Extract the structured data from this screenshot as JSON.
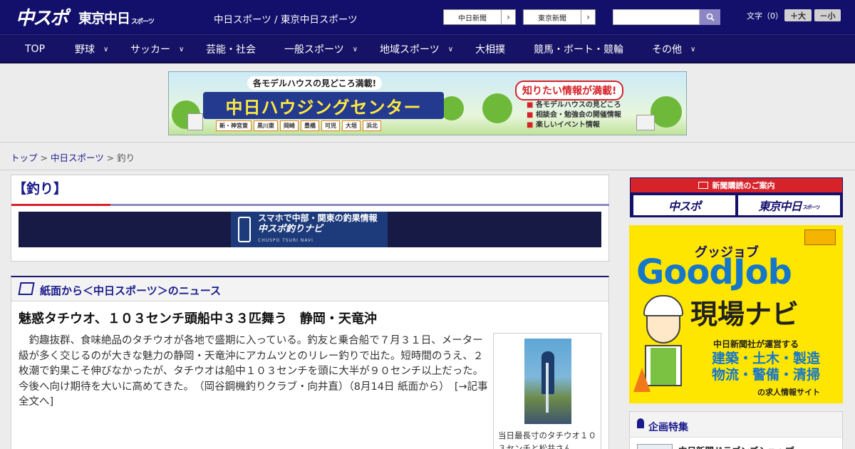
{
  "header": {
    "logo_chuspo": "中スポ",
    "logo_tokyo": "東京中日",
    "logo_tokyo_suffix": "スポーツ",
    "site_title": "中日スポーツ / 東京中日スポーツ",
    "paper_links": [
      {
        "label": "中日新聞",
        "arrow": "›"
      },
      {
        "label": "東京新聞",
        "arrow": "›"
      }
    ],
    "search_placeholder": "",
    "font_size_label": "文字（0）",
    "font_bigger": "＋大",
    "font_smaller": "－小"
  },
  "nav": {
    "items": [
      {
        "label": "TOP",
        "has_menu": false
      },
      {
        "label": "野球",
        "has_menu": true
      },
      {
        "label": "サッカー",
        "has_menu": true
      },
      {
        "label": "芸能・社会",
        "has_menu": false
      },
      {
        "label": "一般スポーツ",
        "has_menu": true
      },
      {
        "label": "地域スポーツ",
        "has_menu": true
      },
      {
        "label": "大相撲",
        "has_menu": false
      },
      {
        "label": "競馬・ボート・競輪",
        "has_menu": false
      },
      {
        "label": "その他",
        "has_menu": true
      }
    ],
    "chevron": "∨"
  },
  "top_ad": {
    "tagline": "各モデルハウスの見どころ満載!",
    "title": "中日ハウジングセンター",
    "areas": [
      "新・神宮東",
      "黒川東",
      "岡崎",
      "豊橋",
      "可児",
      "大垣",
      "浜北"
    ],
    "right_title": "知りたい情報が満載!",
    "right_list": [
      "各モデルハウスの見どころ",
      "相談会・勉強会の開催情報",
      "楽しいイベント情報"
    ]
  },
  "breadcrumb": {
    "items": [
      "トップ",
      "中日スポーツ"
    ],
    "separator": " > ",
    "current": "釣り"
  },
  "category": {
    "title": "【釣り】",
    "banner_line1": "スマホで中部・関東の釣果情報",
    "banner_line2": "中スポ釣りナビ",
    "banner_line3": "CHUSPO TSURI NAVI"
  },
  "news": {
    "section_title": "紙面から＜中日スポーツ＞のニュース",
    "headline": "魅惑タチウオ、１０３センチ頭船中３３匹舞う　静岡・天竜沖",
    "body": "釣趣抜群、食味絶品のタチウオが各地で盛期に入っている。釣友と乗合船で７月３１日、メーター級が多く交じるのが大きな魅力の静岡・天竜沖にアカムツとのリレー釣りで出た。短時間のうえ、２枚潮で釣果こそ伸びなかったが、タチウオは船中１０３センチを頭に大半が９０センチ以上だった。今後へ向け期待を大いに高めてきた。　（岡谷鋼機釣りクラブ・向井直）（8月14日 紙面から）　",
    "more_link": "[→記事全文へ]",
    "photo_caption": "当日最長寸のタチウオ１０３センチと松井さん"
  },
  "sidebar": {
    "subscription_title": "新聞購読のご案内",
    "subscription_chuspo": "中スポ",
    "subscription_tokyo": "東京中日",
    "subscription_tokyo_suffix": "スポーツ",
    "goodjob_kana": "グッジョブ",
    "goodjob_title": "GoodJob",
    "goodjob_navi": "現場ナビ",
    "goodjob_desc1": "中日新聞社が運営する",
    "goodjob_desc2a": "建築・土木・製造",
    "goodjob_desc2b": "物流・警備・清掃",
    "goodjob_desc3": "の求人情報サイト",
    "kikaku_title": "企画特集",
    "kikaku_item": "中日新聞ドラゴンズショップ"
  },
  "colors": {
    "header_bg": "#13106b",
    "accent_red": "#d6232a",
    "link_blue": "#1a1a8c",
    "goodjob_yellow": "#ffe600"
  }
}
